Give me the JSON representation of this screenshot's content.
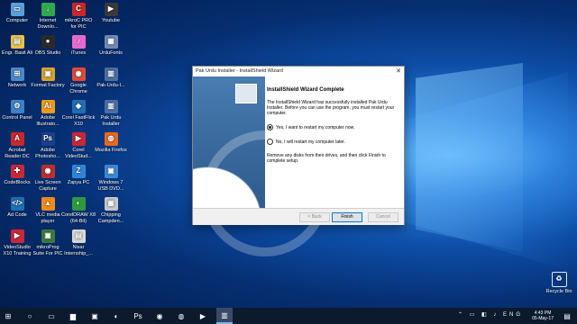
{
  "desktop_icons": [
    {
      "label": "Computer",
      "color": "#5aa0dc",
      "glyph": "▭"
    },
    {
      "label": "Internet Downlo...",
      "color": "#2fa84f",
      "glyph": "↓"
    },
    {
      "label": "mikroC PRO for PIC",
      "color": "#c8282a",
      "glyph": "C"
    },
    {
      "label": "Youtube",
      "color": "#3a3a3a",
      "glyph": "▶"
    },
    {
      "label": "Engr. Basit Ali",
      "color": "#e8c34a",
      "glyph": "▤"
    },
    {
      "label": "OBS Studio",
      "color": "#2a2a2a",
      "glyph": "●"
    },
    {
      "label": "iTunes",
      "color": "#e86ad0",
      "glyph": "♪"
    },
    {
      "label": "UrduFonts",
      "color": "#6c8bb5",
      "glyph": "▦"
    },
    {
      "label": "Network",
      "color": "#4b88c8",
      "glyph": "⊞"
    },
    {
      "label": "Format Factory",
      "color": "#d9a42b",
      "glyph": "▣"
    },
    {
      "label": "Google Chrome",
      "color": "#dd4b39",
      "glyph": "◉"
    },
    {
      "label": "Pak-Urdu-I...",
      "color": "#4a6fa5",
      "glyph": "▥"
    },
    {
      "label": "Control Panel",
      "color": "#3c82c8",
      "glyph": "⚙"
    },
    {
      "label": "Adobe Illustrato...",
      "color": "#f29a1a",
      "glyph": "Ai"
    },
    {
      "label": "Corel FastFlick X10",
      "color": "#1e6fb3",
      "glyph": "◆"
    },
    {
      "label": "Pak Urdu Installer",
      "color": "#4a6fa5",
      "glyph": "▥"
    },
    {
      "label": "Acrobat Reader DC",
      "color": "#c62a2a",
      "glyph": "A"
    },
    {
      "label": "Adobe Photosho...",
      "color": "#1b3f8a",
      "glyph": "Ps"
    },
    {
      "label": "Corel VideoStud...",
      "color": "#c8283a",
      "glyph": "▶"
    },
    {
      "label": "Mozilla Firefox",
      "color": "#e66a1e",
      "glyph": "◍"
    },
    {
      "label": "CodeBlocks",
      "color": "#c8283a",
      "glyph": "✚"
    },
    {
      "label": "Live Screen Capture",
      "color": "#b83030",
      "glyph": "◉"
    },
    {
      "label": "Zapya PC",
      "color": "#2f86d6",
      "glyph": "Z"
    },
    {
      "label": "Windows 7 USB DVD...",
      "color": "#3a8ad6",
      "glyph": "▣"
    },
    {
      "label": "Ad Code",
      "color": "#1e6fb3",
      "glyph": "</>"
    },
    {
      "label": "VLC media player",
      "color": "#f08a1c",
      "glyph": "▲"
    },
    {
      "label": "CorelDRAW X8 (64-Bit)",
      "color": "#2c9b3c",
      "glyph": "◐"
    },
    {
      "label": "Chipping Campden...",
      "color": "#c8c8c8",
      "glyph": "▦"
    },
    {
      "label": "VideoStudio X10 Training",
      "color": "#c8283a",
      "glyph": "▶"
    },
    {
      "label": "mikroProg Suite For PIC",
      "color": "#3a7a3a",
      "glyph": "▣"
    },
    {
      "label": "Nisar Internship_...",
      "color": "#d8d8d8",
      "glyph": "▤"
    }
  ],
  "recycle_bin": {
    "label": "Recycle Bin"
  },
  "dialog": {
    "title": "Pak Urdu Installer - InstallShield Wizard",
    "heading": "InstallShield Wizard Complete",
    "body": "The InstallShield Wizard has successfully installed Pak Urdu Installer. Before you can use the program, you must restart your computer.",
    "option_yes": "Yes, I want to restart my computer now.",
    "option_no": "No, I will restart my computer later.",
    "note": "Remove any disks from their drives, and then click Finish to complete setup.",
    "back_label": "< Back",
    "finish_label": "Finish",
    "cancel_label": "Cancel",
    "selected_option": "yes"
  },
  "taskbar": {
    "time": "4:43 PM",
    "date": "05-May-17"
  }
}
